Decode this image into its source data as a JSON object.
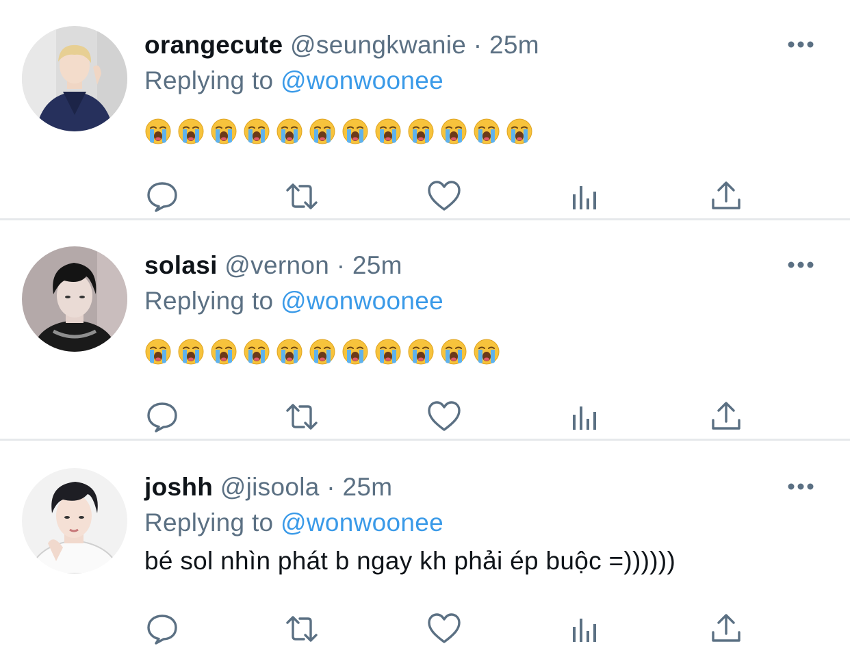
{
  "colors": {
    "name": "#0f1419",
    "secondary": "#5b7083",
    "mention": "#3a9ae8",
    "icon": "#5b7083",
    "divider": "#e6e9eb"
  },
  "reply_prefix": "Replying to",
  "icons": {
    "more": "more-options-icon",
    "reply": "reply-bubble-icon",
    "retweet": "retweet-icon",
    "like": "heart-icon",
    "analytics": "analytics-icon",
    "share": "share-upload-icon",
    "emoji": "loudly-crying-face-emoji"
  },
  "tweets": [
    {
      "display_name": "orangecute",
      "handle": "@seungkwanie",
      "separator": "·",
      "time": "25m",
      "replying_to": "@wonwoonee",
      "emoji_count": 12,
      "text": ""
    },
    {
      "display_name": "solasi",
      "handle": "@vernon",
      "separator": "·",
      "time": "25m",
      "replying_to": "@wonwoonee",
      "emoji_count": 11,
      "text": ""
    },
    {
      "display_name": "joshh",
      "handle": "@jisoola",
      "separator": "·",
      "time": "25m",
      "replying_to": "@wonwoonee",
      "emoji_count": 0,
      "text": "bé sol nhìn phát b ngay kh phải ép buộc =))))))"
    }
  ]
}
